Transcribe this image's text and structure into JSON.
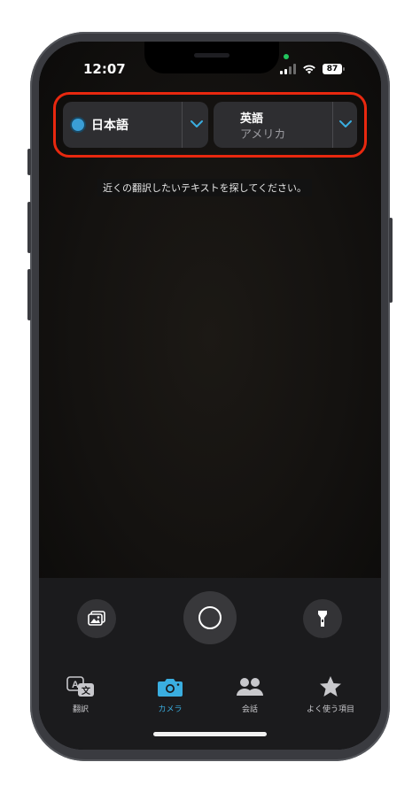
{
  "status_bar": {
    "time": "12:07",
    "battery": "87"
  },
  "language_selector": {
    "source": {
      "name": "日本語"
    },
    "target": {
      "name": "英語",
      "variant": "アメリカ"
    }
  },
  "hint_text": "近くの翻訳したいテキストを探してください。",
  "controls": {
    "gallery_icon": "photo-library-icon",
    "shutter_icon": "shutter-icon",
    "flashlight_icon": "flashlight-icon"
  },
  "tabs": [
    {
      "label": "翻訳",
      "icon": "translate-icon"
    },
    {
      "label": "カメラ",
      "icon": "camera-icon",
      "active": true
    },
    {
      "label": "会話",
      "icon": "conversation-icon"
    },
    {
      "label": "よく使う項目",
      "icon": "star-icon"
    }
  ],
  "colors": {
    "accent": "#3aaee0",
    "highlight_border": "#e8280f",
    "status_dot": "#22c55e"
  }
}
